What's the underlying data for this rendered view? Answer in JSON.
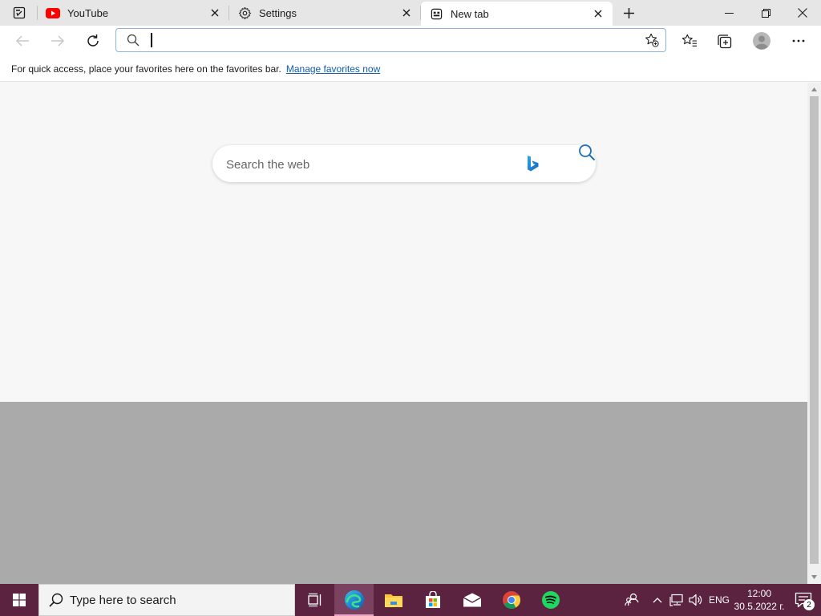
{
  "tabs": [
    {
      "title": "YouTube",
      "icon": "youtube-icon",
      "active": false
    },
    {
      "title": "Settings",
      "icon": "gear-icon",
      "active": false
    },
    {
      "title": "New tab",
      "icon": "new-tab-page-icon",
      "active": true
    }
  ],
  "toolbar": {
    "address_value": "",
    "buttons": [
      "back-icon",
      "forward-icon",
      "refresh-icon",
      "favorites-icon",
      "collections-icon",
      "profile-icon",
      "more-icon"
    ]
  },
  "favorites_bar": {
    "message": "For quick access, place your favorites here on the favorites bar.",
    "link": "Manage favorites now"
  },
  "content": {
    "search_placeholder": "Search the web"
  },
  "taskbar": {
    "search_placeholder": "Type here to search",
    "apps": [
      "task-view-icon",
      "edge-icon",
      "file-explorer-icon",
      "store-icon",
      "mail-icon",
      "chrome-icon",
      "spotify-icon"
    ],
    "language": "ENG",
    "time": "12:00",
    "date": "30.5.2022 г.",
    "notification_count": "2"
  },
  "colors": {
    "accent": "#0f5cab",
    "taskbar": "#5b2340",
    "youtube_red": "#ff0000",
    "spotify_green": "#1ed760"
  }
}
